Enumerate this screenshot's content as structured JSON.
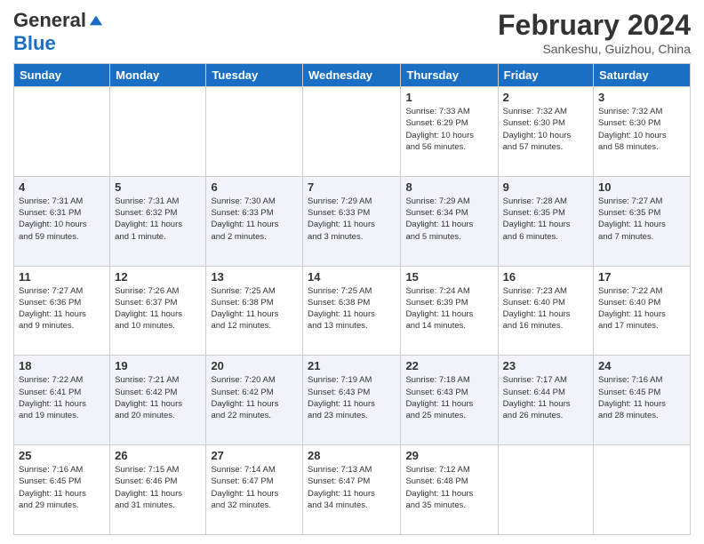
{
  "header": {
    "logo_general": "General",
    "logo_blue": "Blue",
    "month_title": "February 2024",
    "subtitle": "Sankeshu, Guizhou, China"
  },
  "weekdays": [
    "Sunday",
    "Monday",
    "Tuesday",
    "Wednesday",
    "Thursday",
    "Friday",
    "Saturday"
  ],
  "weeks": [
    [
      {
        "day": "",
        "info": ""
      },
      {
        "day": "",
        "info": ""
      },
      {
        "day": "",
        "info": ""
      },
      {
        "day": "",
        "info": ""
      },
      {
        "day": "1",
        "info": "Sunrise: 7:33 AM\nSunset: 6:29 PM\nDaylight: 10 hours\nand 56 minutes."
      },
      {
        "day": "2",
        "info": "Sunrise: 7:32 AM\nSunset: 6:30 PM\nDaylight: 10 hours\nand 57 minutes."
      },
      {
        "day": "3",
        "info": "Sunrise: 7:32 AM\nSunset: 6:30 PM\nDaylight: 10 hours\nand 58 minutes."
      }
    ],
    [
      {
        "day": "4",
        "info": "Sunrise: 7:31 AM\nSunset: 6:31 PM\nDaylight: 10 hours\nand 59 minutes."
      },
      {
        "day": "5",
        "info": "Sunrise: 7:31 AM\nSunset: 6:32 PM\nDaylight: 11 hours\nand 1 minute."
      },
      {
        "day": "6",
        "info": "Sunrise: 7:30 AM\nSunset: 6:33 PM\nDaylight: 11 hours\nand 2 minutes."
      },
      {
        "day": "7",
        "info": "Sunrise: 7:29 AM\nSunset: 6:33 PM\nDaylight: 11 hours\nand 3 minutes."
      },
      {
        "day": "8",
        "info": "Sunrise: 7:29 AM\nSunset: 6:34 PM\nDaylight: 11 hours\nand 5 minutes."
      },
      {
        "day": "9",
        "info": "Sunrise: 7:28 AM\nSunset: 6:35 PM\nDaylight: 11 hours\nand 6 minutes."
      },
      {
        "day": "10",
        "info": "Sunrise: 7:27 AM\nSunset: 6:35 PM\nDaylight: 11 hours\nand 7 minutes."
      }
    ],
    [
      {
        "day": "11",
        "info": "Sunrise: 7:27 AM\nSunset: 6:36 PM\nDaylight: 11 hours\nand 9 minutes."
      },
      {
        "day": "12",
        "info": "Sunrise: 7:26 AM\nSunset: 6:37 PM\nDaylight: 11 hours\nand 10 minutes."
      },
      {
        "day": "13",
        "info": "Sunrise: 7:25 AM\nSunset: 6:38 PM\nDaylight: 11 hours\nand 12 minutes."
      },
      {
        "day": "14",
        "info": "Sunrise: 7:25 AM\nSunset: 6:38 PM\nDaylight: 11 hours\nand 13 minutes."
      },
      {
        "day": "15",
        "info": "Sunrise: 7:24 AM\nSunset: 6:39 PM\nDaylight: 11 hours\nand 14 minutes."
      },
      {
        "day": "16",
        "info": "Sunrise: 7:23 AM\nSunset: 6:40 PM\nDaylight: 11 hours\nand 16 minutes."
      },
      {
        "day": "17",
        "info": "Sunrise: 7:22 AM\nSunset: 6:40 PM\nDaylight: 11 hours\nand 17 minutes."
      }
    ],
    [
      {
        "day": "18",
        "info": "Sunrise: 7:22 AM\nSunset: 6:41 PM\nDaylight: 11 hours\nand 19 minutes."
      },
      {
        "day": "19",
        "info": "Sunrise: 7:21 AM\nSunset: 6:42 PM\nDaylight: 11 hours\nand 20 minutes."
      },
      {
        "day": "20",
        "info": "Sunrise: 7:20 AM\nSunset: 6:42 PM\nDaylight: 11 hours\nand 22 minutes."
      },
      {
        "day": "21",
        "info": "Sunrise: 7:19 AM\nSunset: 6:43 PM\nDaylight: 11 hours\nand 23 minutes."
      },
      {
        "day": "22",
        "info": "Sunrise: 7:18 AM\nSunset: 6:43 PM\nDaylight: 11 hours\nand 25 minutes."
      },
      {
        "day": "23",
        "info": "Sunrise: 7:17 AM\nSunset: 6:44 PM\nDaylight: 11 hours\nand 26 minutes."
      },
      {
        "day": "24",
        "info": "Sunrise: 7:16 AM\nSunset: 6:45 PM\nDaylight: 11 hours\nand 28 minutes."
      }
    ],
    [
      {
        "day": "25",
        "info": "Sunrise: 7:16 AM\nSunset: 6:45 PM\nDaylight: 11 hours\nand 29 minutes."
      },
      {
        "day": "26",
        "info": "Sunrise: 7:15 AM\nSunset: 6:46 PM\nDaylight: 11 hours\nand 31 minutes."
      },
      {
        "day": "27",
        "info": "Sunrise: 7:14 AM\nSunset: 6:47 PM\nDaylight: 11 hours\nand 32 minutes."
      },
      {
        "day": "28",
        "info": "Sunrise: 7:13 AM\nSunset: 6:47 PM\nDaylight: 11 hours\nand 34 minutes."
      },
      {
        "day": "29",
        "info": "Sunrise: 7:12 AM\nSunset: 6:48 PM\nDaylight: 11 hours\nand 35 minutes."
      },
      {
        "day": "",
        "info": ""
      },
      {
        "day": "",
        "info": ""
      }
    ]
  ]
}
